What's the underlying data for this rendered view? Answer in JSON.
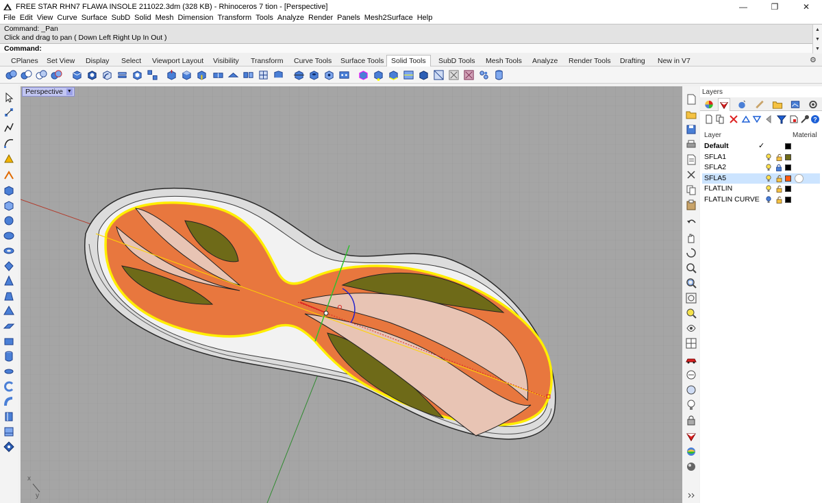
{
  "window": {
    "title": "FREE STAR RHN7 FLAWA INSOLE 211022.3dm (328 KB) - Rhinoceros 7 tion - [Perspective]",
    "minimize": "—",
    "restore": "❐",
    "close": "✕"
  },
  "menu": [
    "File",
    "Edit",
    "View",
    "Curve",
    "Surface",
    "SubD",
    "Solid",
    "Mesh",
    "Dimension",
    "Transform",
    "Tools",
    "Analyze",
    "Render",
    "Panels",
    "Mesh2Surface",
    "Help"
  ],
  "command": {
    "history1": "Command: _Pan",
    "history2": "Click and drag to pan ( Down  Left  Right  Up  In  Out )",
    "prompt": "Command:"
  },
  "tabs": [
    "CPlanes",
    "Set View",
    "Display",
    "Select",
    "Viewport Layout",
    "Visibility",
    "Transform",
    "Curve Tools",
    "Surface Tools",
    "Solid Tools",
    "SubD Tools",
    "Mesh Tools",
    "Analyze",
    "Render Tools",
    "Drafting",
    "New in V7"
  ],
  "active_tab": "Solid Tools",
  "viewport": {
    "label": "Perspective",
    "axis_x": "x",
    "axis_y": "y"
  },
  "layers_panel": {
    "title": "Layers",
    "col_layer": "Layer",
    "col_material": "Material",
    "rows": [
      {
        "name": "Default",
        "current": true,
        "check": "✓",
        "color": "#000000"
      },
      {
        "name": "SFLA1",
        "color": "#6e6a18"
      },
      {
        "name": "SFLA2",
        "color": "#000000"
      },
      {
        "name": "SFLA5",
        "color": "#ff5a10",
        "selected": true
      },
      {
        "name": "FLATLIN",
        "color": "#000000"
      },
      {
        "name": "FLATLIN CURVE",
        "color": "#000000"
      }
    ]
  },
  "colors": {
    "accent_orange": "#e8773e",
    "olive": "#6e6a18",
    "highlight_yellow": "#ffee00",
    "viewport_bg": "#a5a5a5",
    "selection_blue": "#cce4ff"
  }
}
